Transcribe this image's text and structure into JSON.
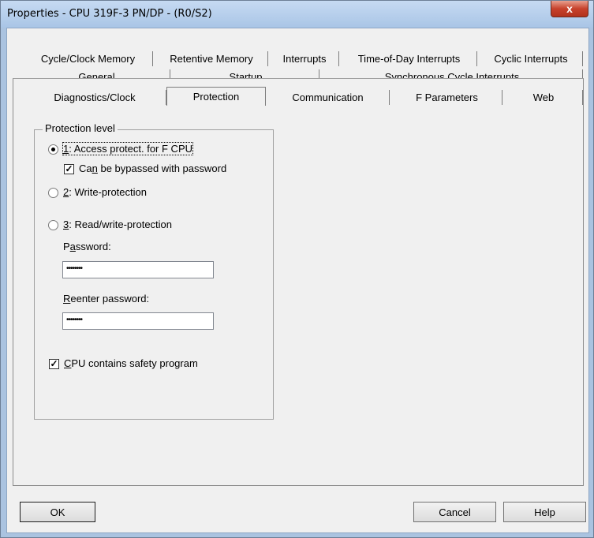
{
  "window": {
    "title": "Properties - CPU 319F-3 PN/DP - (R0/S2)",
    "close_label": "x"
  },
  "tabs": {
    "row1": [
      "Cycle/Clock Memory",
      "Retentive Memory",
      "Interrupts",
      "Time-of-Day Interrupts",
      "Cyclic Interrupts"
    ],
    "row2": [
      "General",
      "Startup",
      "Synchronous Cycle Interrupts"
    ],
    "row3": [
      "Diagnostics/Clock",
      "Protection",
      "Communication",
      "F Parameters",
      "Web"
    ],
    "active": "Protection"
  },
  "protection": {
    "legend": "Protection level",
    "opt1_num": "1",
    "opt1_rest": ": Access protect. for F CPU",
    "bypass_pre": "Ca",
    "bypass_u": "n",
    "bypass_post": " be bypassed with password",
    "opt2_num": "2",
    "opt2_rest": ": Write-protection",
    "opt3_num": "3",
    "opt3_rest": ": Read/write-protection",
    "password_u": "a",
    "password_pre": "P",
    "password_post": "ssword:",
    "password_value": "••••••••",
    "reenter_u": "R",
    "reenter_post": "eenter password:",
    "reenter_value": "••••••••",
    "safety_u": "C",
    "safety_post": "PU contains safety program",
    "selected_level": 1,
    "bypass_checked": true,
    "safety_checked": true
  },
  "buttons": {
    "ok": "OK",
    "cancel": "Cancel",
    "help": "Help"
  }
}
